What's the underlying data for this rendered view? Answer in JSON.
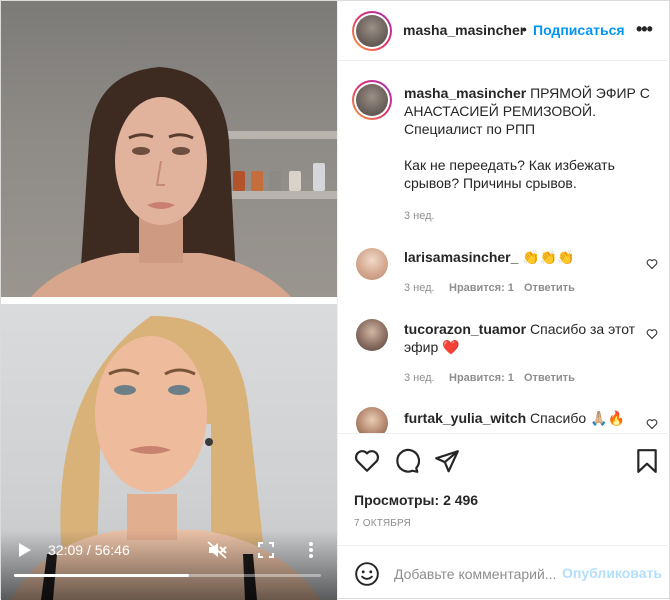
{
  "video": {
    "time_current": "32:09",
    "time_sep": " / ",
    "time_total": "56:46",
    "progress": 0.57
  },
  "header": {
    "username": "masha_masincher",
    "dot": "•",
    "follow_label": "Подписаться",
    "more": "•••"
  },
  "caption": {
    "username": "masha_masincher",
    "line1": "ПРЯМОЙ ЭФИР С АНАСТАСИЕЙ РЕМИЗОВОЙ.",
    "line2": "Специалист по РПП",
    "line3": "Как не переедать? Как избежать срывов? Причины срывов.",
    "age": "3 нед."
  },
  "comments": [
    {
      "username": "larisamasincher_",
      "text": "👏👏👏",
      "age": "3 нед.",
      "likes": "Нравится: 1",
      "reply": "Ответить"
    },
    {
      "username": "tucorazon_tuamor",
      "text": "Спасибо за этот эфир ❤️",
      "age": "3 нед.",
      "likes": "Нравится: 1",
      "reply": "Ответить"
    },
    {
      "username": "furtak_yulia_witch",
      "text": "Спасибо 🙏🏼🔥"
    }
  ],
  "stats": {
    "views_label": "Просмотры:",
    "views_value": "2 496",
    "date": "7 ОКТЯБРЯ"
  },
  "add_comment": {
    "placeholder": "Добавьте комментарий...",
    "publish_label": "Опубликовать"
  },
  "colors": {
    "accent": "#0095f6",
    "accent_disabled": "#b2dffc",
    "heart_red": "#ed4956"
  }
}
